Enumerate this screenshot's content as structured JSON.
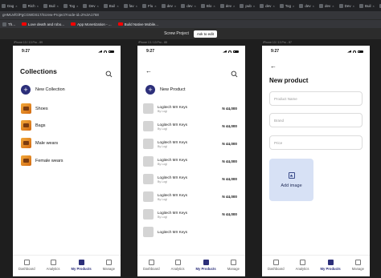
{
  "browser": {
    "tabs": [
      "Dag",
      "Rich",
      "Buil",
      "Tog",
      "Dev",
      "Buil",
      "fav",
      "Flu",
      "dev",
      "dev",
      "Blo",
      "dev",
      "pub",
      "dev",
      "Tog",
      "dev",
      "dev",
      "Dev",
      "Buil",
      "Fluk",
      "Flut",
      "dev",
      "Buil",
      "Buil",
      "Buil",
      "Dev",
      "Buil",
      "Dev",
      "Buil",
      "Buil",
      "Buil",
      "Dev",
      "Ear",
      "Sea",
      "Dev",
      "fav",
      "bee"
    ],
    "url": "gHMUvfGlPgCGWDS17/Screw-Project?node-id=2%3A1768",
    "bookmarks": [
      "Th...",
      "Love death and robo...",
      "App Monetization - ...",
      "Build Native Mobile..."
    ]
  },
  "figma": {
    "title": "Screw Project",
    "ask_to_edit": "Ask to edit",
    "frame_labels": [
      "iPhone 13 / 13 Pro - 89",
      "iPhone 13 / 13 Pro - 88",
      "iPhone 13 / 13 Pro - 87"
    ]
  },
  "status_time": "9:27",
  "screen1": {
    "title": "Collections",
    "new_label": "New Collection",
    "items": [
      "Shoes",
      "Bags",
      "Male wears",
      "Female wears"
    ]
  },
  "screen2": {
    "new_label": "New Product",
    "products": [
      {
        "name": "Logitech MX Keys",
        "brand": "By Logi",
        "price": "N 44,000"
      },
      {
        "name": "Logitech MX Keys",
        "brand": "By Logi",
        "price": "N 44,000"
      },
      {
        "name": "Logitech MX Keys",
        "brand": "By Logi",
        "price": "N 44,000"
      },
      {
        "name": "Logitech MX Keys",
        "brand": "By Logi",
        "price": "N 44,000"
      },
      {
        "name": "Logitech MX Keys",
        "brand": "By Logi",
        "price": "N 44,000"
      },
      {
        "name": "Logitech MX Keys",
        "brand": "By Logi",
        "price": "N 44,000"
      },
      {
        "name": "Logitech MX Keys",
        "brand": "By Logi",
        "price": "N 44,000"
      },
      {
        "name": "Logitech MX Keys",
        "brand": "",
        "price": ""
      }
    ]
  },
  "screen3": {
    "title": "New product",
    "fields": [
      "Product Name",
      "Brand",
      "Price"
    ],
    "add_image": "Add image"
  },
  "nav": [
    "Dashboard",
    "Analytics",
    "My Products",
    "Manage"
  ],
  "nav_active_index": 2,
  "colors": {
    "primary": "#2c2f7a",
    "image_box": "#d7e1f5"
  }
}
